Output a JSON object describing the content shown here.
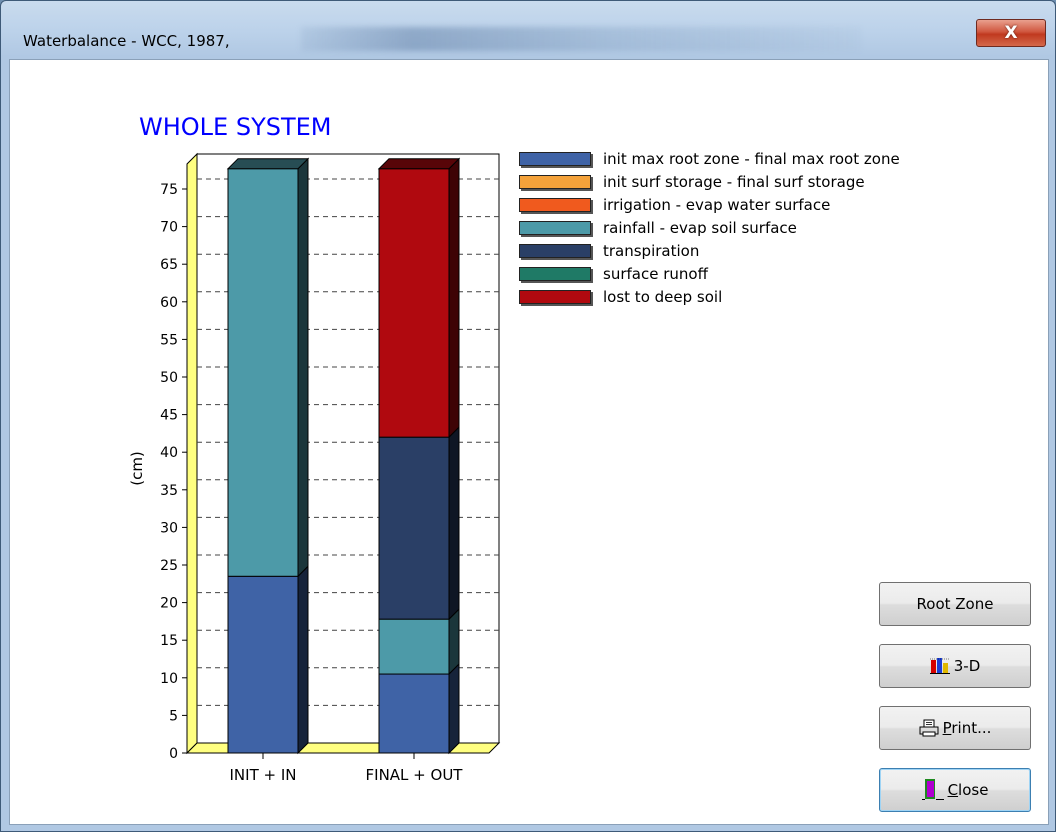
{
  "window": {
    "title": "Waterbalance - WCC, 1987,",
    "close_glyph": "X"
  },
  "chart_title": "WHOLE SYSTEM",
  "legend": [
    {
      "label": "init max root zone - final max root zone",
      "color": "#3f63a6"
    },
    {
      "label": "init surf storage - final surf storage",
      "color": "#f4a23a"
    },
    {
      "label": "irrigation - evap water surface",
      "color": "#f05a1e"
    },
    {
      "label": "rainfall - evap soil surface",
      "color": "#4d9aa8"
    },
    {
      "label": "transpiration",
      "color": "#2a3f66"
    },
    {
      "label": "surface runoff",
      "color": "#1f7a66"
    },
    {
      "label": "lost to deep soil",
      "color": "#b0090f"
    }
  ],
  "chart_data": {
    "type": "bar",
    "stacked": true,
    "categories": [
      "INIT + IN",
      "FINAL + OUT"
    ],
    "series": [
      {
        "name": "init max root zone - final max root zone",
        "values": [
          23.5,
          10.5
        ]
      },
      {
        "name": "init surf storage - final surf storage",
        "values": [
          0,
          0
        ]
      },
      {
        "name": "irrigation - evap water surface",
        "values": [
          0,
          0
        ]
      },
      {
        "name": "rainfall - evap soil surface",
        "values": [
          54.2,
          7.3
        ]
      },
      {
        "name": "transpiration",
        "values": [
          0,
          24.2
        ]
      },
      {
        "name": "surface runoff",
        "values": [
          0,
          0
        ]
      },
      {
        "name": "lost to deep soil",
        "values": [
          0,
          35.7
        ]
      }
    ],
    "ylabel": "(cm)",
    "ylim": [
      0,
      75
    ],
    "yticks": [
      "0",
      "5",
      "10",
      "15",
      "20",
      "25",
      "30",
      "35",
      "40",
      "45",
      "50",
      "55",
      "60",
      "65",
      "70",
      "75"
    ],
    "grid": true,
    "legend_position": "top-right"
  },
  "buttons": {
    "root_zone": "Root Zone",
    "three_d": "3-D",
    "print_pre": "P",
    "print_rest": "rint...",
    "close_pre": "C",
    "close_rest": "lose"
  }
}
